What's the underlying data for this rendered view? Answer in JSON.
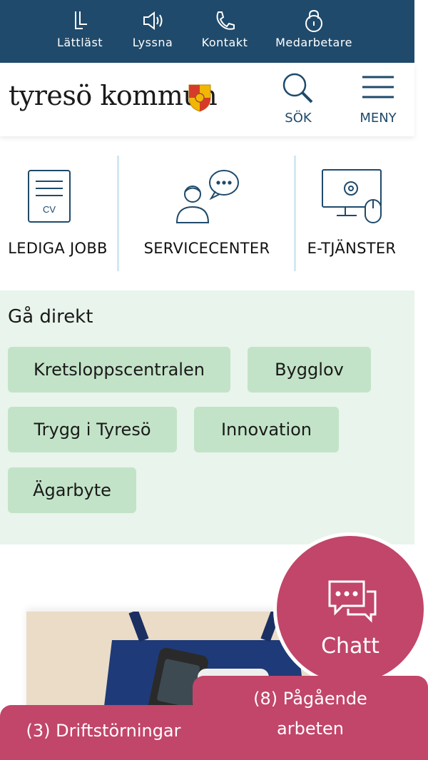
{
  "topbar": {
    "items": [
      {
        "label": "Lättläst",
        "icon": "easy-read-icon"
      },
      {
        "label": "Lyssna",
        "icon": "speaker-icon"
      },
      {
        "label": "Kontakt",
        "icon": "phone-icon"
      },
      {
        "label": "Medarbetare",
        "icon": "lock-icon"
      }
    ]
  },
  "header": {
    "logo_text": "tyresö kommun",
    "search_label": "SÖK",
    "menu_label": "MENY"
  },
  "quicklinks": [
    {
      "label": "LEDIGA JOBB",
      "icon": "cv-document-icon",
      "icon_text": "CV"
    },
    {
      "label": "SERVICECENTER",
      "icon": "person-chat-icon"
    },
    {
      "label": "E-TJÄNSTER",
      "icon": "computer-icon"
    }
  ],
  "direct": {
    "title": "Gå direkt",
    "chips": [
      "Kretsloppscentralen",
      "Bygglov",
      "Trygg i Tyresö",
      "Innovation",
      "Ägarbyte"
    ]
  },
  "chat": {
    "label": "Chatt"
  },
  "bottom_tabs": {
    "disruptions": "(3) Driftstörningar",
    "works_line1": "(8) Pågående",
    "works_line2": "arbeten"
  },
  "colors": {
    "topbar_bg": "#1f4a6b",
    "accent_pink": "#c2456a",
    "chip_bg": "#c2e3c7",
    "direct_bg": "#e9f4ec"
  }
}
